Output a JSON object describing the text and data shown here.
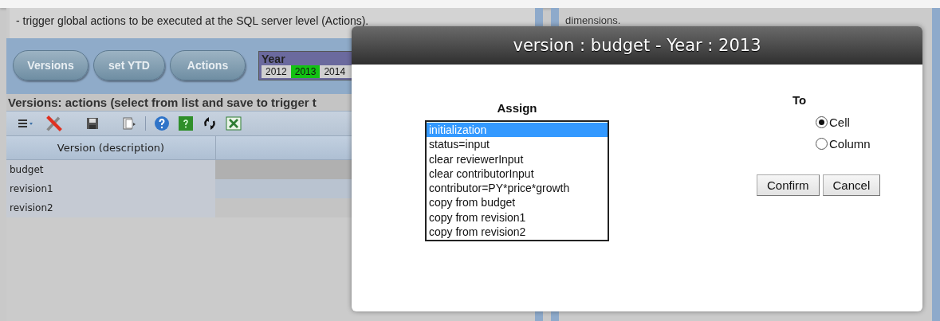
{
  "info_text": "- trigger global actions to be executed at the SQL server level (Actions).",
  "right_panel_text": "dimensions.",
  "nav_buttons": [
    "Versions",
    "set YTD",
    "Actions"
  ],
  "year_selector": {
    "label": "Year",
    "years": [
      {
        "label": "2012",
        "selected": false
      },
      {
        "label": "2013",
        "selected": true
      },
      {
        "label": "2014",
        "selected": false
      }
    ]
  },
  "section_title": "Versions: actions (select from list and save to trigger t",
  "toolbar": [
    {
      "kind": "menu"
    },
    {
      "kind": "tools"
    },
    {
      "kind": "gap"
    },
    {
      "kind": "save"
    },
    {
      "kind": "gap"
    },
    {
      "kind": "export"
    },
    {
      "kind": "separator"
    },
    {
      "kind": "help"
    },
    {
      "kind": "green-help"
    },
    {
      "kind": "refresh"
    },
    {
      "kind": "excel"
    }
  ],
  "table": {
    "columns": [
      "Version (description)"
    ],
    "rows": [
      {
        "label": "budget",
        "selected": true
      },
      {
        "label": "revision1",
        "selected": false
      },
      {
        "label": "revision2",
        "selected": false
      }
    ]
  },
  "dialog": {
    "title": "version : budget - Year : 2013",
    "assign": {
      "label": "Assign",
      "options": [
        {
          "label": "initialization",
          "selected": true
        },
        {
          "label": "status=input",
          "selected": false
        },
        {
          "label": "clear reviewerInput",
          "selected": false
        },
        {
          "label": "clear contributorInput",
          "selected": false
        },
        {
          "label": "contributor=PY*price*growth",
          "selected": false
        },
        {
          "label": "copy from budget",
          "selected": false
        },
        {
          "label": "copy from revision1",
          "selected": false
        },
        {
          "label": "copy from revision2",
          "selected": false
        }
      ]
    },
    "to": {
      "label": "To",
      "options": [
        {
          "label": "Cell",
          "selected": true
        },
        {
          "label": "Column",
          "selected": false
        }
      ]
    },
    "buttons": [
      "Confirm",
      "Cancel"
    ]
  }
}
